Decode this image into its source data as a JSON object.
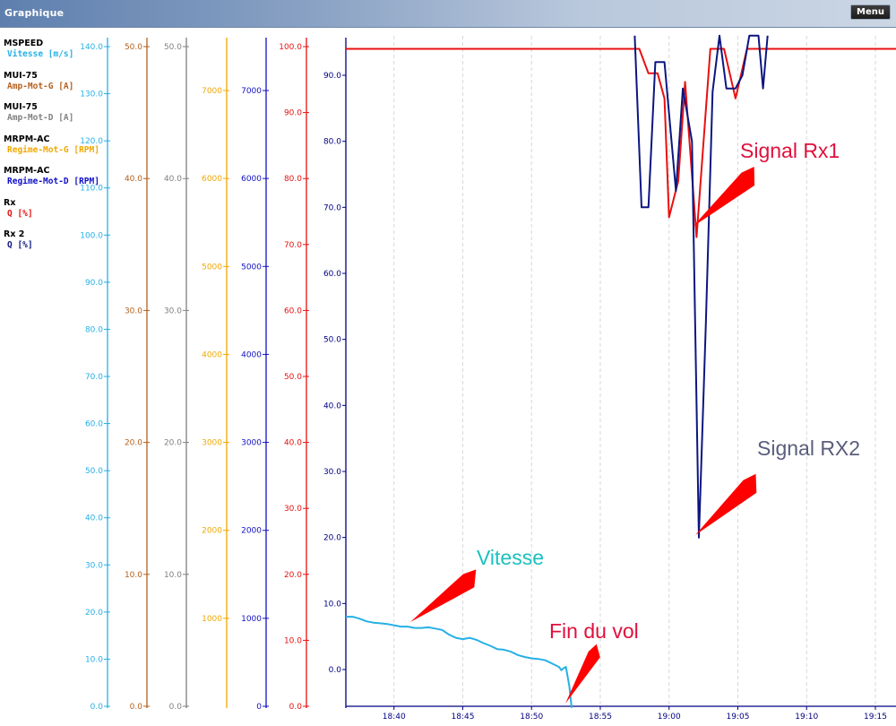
{
  "window": {
    "title": "Graphique",
    "menu_label": "Menu"
  },
  "legend": [
    {
      "source": "MSPEED",
      "label": "Vitesse [m/s]",
      "color": "#26b0e6"
    },
    {
      "source": "MUI-75",
      "label": "Amp-Mot-G [A]",
      "color": "#b4601e"
    },
    {
      "source": "MUI-75",
      "label": "Amp-Mot-D [A]",
      "color": "#808080"
    },
    {
      "source": "MRPM-AC",
      "label": "Regime-Mot-G [RPM]",
      "color": "#f0a800"
    },
    {
      "source": "MRPM-AC",
      "label": "Regime-Mot-D [RPM]",
      "color": "#1010c8"
    },
    {
      "source": "Rx",
      "label": "Q [%]",
      "color": "#e81010"
    },
    {
      "source": "Rx 2",
      "label": "Q [%]",
      "color": "#0c1680"
    }
  ],
  "annotations": {
    "signal_rx1": "Signal Rx1",
    "signal_rx2": "Signal RX2",
    "vitesse": "Vitesse",
    "fin_du_vol": "Fin du vol"
  },
  "annotation_colors": {
    "signal_rx1": "#e0103c",
    "signal_rx2": "#5a5e7c",
    "vitesse": "#1cc0c0",
    "fin_du_vol": "#e0103c",
    "arrow": "#ff0000"
  },
  "chart_data": {
    "type": "line",
    "title": "",
    "x": {
      "type": "time",
      "ticks": [
        "18:40",
        "18:45",
        "18:50",
        "18:55",
        "19:00",
        "19:05",
        "19:10",
        "19:15"
      ],
      "grid": "vertical dashed",
      "range": [
        "18:36:30",
        "19:16:30"
      ]
    },
    "axes": [
      {
        "id": "vitesse",
        "min": 0,
        "max": 140,
        "ticks": [
          "0.0",
          "10.0",
          "20.0",
          "30.0",
          "40.0",
          "50.0",
          "60.0",
          "70.0",
          "80.0",
          "90.0",
          "100.0",
          "110.0",
          "120.0",
          "130.0",
          "140.0"
        ],
        "color": "#26b0e6"
      },
      {
        "id": "amp_g",
        "min": 0,
        "max": 50,
        "ticks": [
          "0.0",
          "10.0",
          "20.0",
          "30.0",
          "40.0",
          "50.0"
        ],
        "color": "#b4601e"
      },
      {
        "id": "amp_d",
        "min": 0,
        "max": 50,
        "ticks": [
          "0.0",
          "10.0",
          "20.0",
          "30.0",
          "40.0",
          "50.0"
        ],
        "color": "#808080"
      },
      {
        "id": "regime_g",
        "min": 0,
        "max": 7000,
        "ticks": [
          "1000",
          "2000",
          "3000",
          "4000",
          "5000",
          "6000",
          "7000"
        ],
        "color": "#f0a800"
      },
      {
        "id": "regime_d",
        "min": 0,
        "max": 7000,
        "ticks": [
          "0",
          "1000",
          "2000",
          "3000",
          "4000",
          "5000",
          "6000",
          "7000"
        ],
        "color": "#1010c8"
      },
      {
        "id": "rx",
        "min": 0,
        "max": 100,
        "ticks": [
          "0.0",
          "10.0",
          "20.0",
          "30.0",
          "40.0",
          "50.0",
          "60.0",
          "70.0",
          "80.0",
          "90.0",
          "100.0"
        ],
        "color": "#e81010"
      },
      {
        "id": "main",
        "min": -5.8,
        "max": 96,
        "ticks": [
          "0.0",
          "10.0",
          "20.0",
          "30.0",
          "40.0",
          "50.0",
          "60.0",
          "70.0",
          "80.0",
          "90.0"
        ],
        "color": "#000080"
      }
    ],
    "series": [
      {
        "axis": "main",
        "color": "#26b0e6",
        "points": [
          [
            "18:36:30",
            8.0
          ],
          [
            "18:37:00",
            8.0
          ],
          [
            "18:37:30",
            7.7
          ],
          [
            "18:38:00",
            7.3
          ],
          [
            "18:38:30",
            7.1
          ],
          [
            "18:39:00",
            7.0
          ],
          [
            "18:39:30",
            6.9
          ],
          [
            "18:40:00",
            6.7
          ],
          [
            "18:40:30",
            6.5
          ],
          [
            "18:41:00",
            6.5
          ],
          [
            "18:41:30",
            6.3
          ],
          [
            "18:42:00",
            6.3
          ],
          [
            "18:42:30",
            6.4
          ],
          [
            "18:43:00",
            6.2
          ],
          [
            "18:43:30",
            6.0
          ],
          [
            "18:44:00",
            5.3
          ],
          [
            "18:44:30",
            4.8
          ],
          [
            "18:45:00",
            4.6
          ],
          [
            "18:45:30",
            4.8
          ],
          [
            "18:46:00",
            4.5
          ],
          [
            "18:46:30",
            4.0
          ],
          [
            "18:47:00",
            3.6
          ],
          [
            "18:47:30",
            3.1
          ],
          [
            "18:48:00",
            3.0
          ],
          [
            "18:48:30",
            2.7
          ],
          [
            "18:49:00",
            2.2
          ],
          [
            "18:49:30",
            1.9
          ],
          [
            "18:50:00",
            1.7
          ],
          [
            "18:50:30",
            1.6
          ],
          [
            "18:51:00",
            1.4
          ],
          [
            "18:51:30",
            0.9
          ],
          [
            "18:52:00",
            0.4
          ],
          [
            "18:52:10",
            -0.1
          ],
          [
            "18:52:20",
            0.2
          ],
          [
            "18:52:30",
            0.4
          ],
          [
            "18:52:45",
            -2.5
          ],
          [
            "18:52:55",
            -5.8
          ]
        ]
      },
      {
        "axis": "main",
        "color": "#e81010",
        "points": [
          [
            "18:36:30",
            94.0
          ],
          [
            "18:57:50",
            94.0
          ],
          [
            "18:58:30",
            90.3
          ],
          [
            "18:59:10",
            90.3
          ],
          [
            "18:59:40",
            86.5
          ],
          [
            "19:00:00",
            68.5
          ],
          [
            "19:00:40",
            74.0
          ],
          [
            "19:01:10",
            89.0
          ],
          [
            "19:02:00",
            65.5
          ],
          [
            "19:03:00",
            94.0
          ],
          [
            "19:04:00",
            94.0
          ],
          [
            "19:04:50",
            86.5
          ],
          [
            "19:05:40",
            94.0
          ],
          [
            "19:16:30",
            94.0
          ]
        ]
      },
      {
        "axis": "main",
        "color": "#0c1680",
        "points": [
          [
            "18:57:30",
            96.0
          ],
          [
            "18:58:00",
            70.0
          ],
          [
            "18:58:30",
            70.0
          ],
          [
            "18:59:00",
            92.0
          ],
          [
            "18:59:40",
            92.0
          ],
          [
            "19:00:30",
            72.5
          ],
          [
            "19:01:00",
            88.0
          ],
          [
            "19:01:40",
            80.0
          ],
          [
            "19:02:10",
            20.0
          ],
          [
            "19:02:40",
            52.0
          ],
          [
            "19:03:10",
            87.5
          ],
          [
            "19:03:40",
            96.0
          ],
          [
            "19:04:10",
            88.0
          ],
          [
            "19:04:50",
            88.0
          ],
          [
            "19:05:20",
            90.0
          ],
          [
            "19:05:50",
            96.0
          ],
          [
            "19:06:30",
            96.0
          ],
          [
            "19:06:50",
            88.0
          ],
          [
            "19:07:10",
            96.0
          ]
        ]
      }
    ]
  }
}
